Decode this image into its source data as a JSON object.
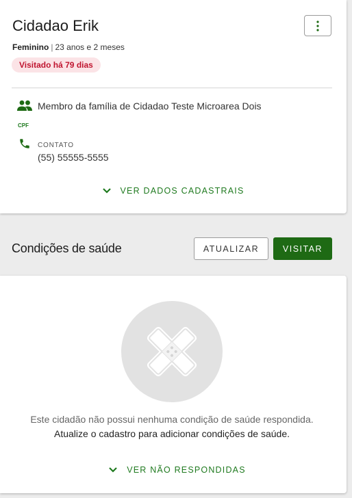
{
  "patient": {
    "name": "Cidadao Erik",
    "gender": "Feminino",
    "separator": "|",
    "age": "23 anos e 2 meses",
    "visit_badge": "Visitado há 79 dias",
    "family_text": "Membro da família de Cidadao Teste Microarea Dois",
    "cpf_tag": "CPF",
    "contact_label": "CONTATO",
    "contact_value": "(55) 55555-5555",
    "more_link": "VER DADOS CADASTRAIS"
  },
  "health": {
    "title": "Condições de saúde",
    "update_button": "ATUALIZAR",
    "visit_button": "VISITAR",
    "empty_line1": "Este cidadão não possui nenhuma condição de saúde respondida.",
    "empty_line2": "Atualize o cadastro para adicionar condições de saúde.",
    "unanswered_link": "VER NÃO RESPONDIDAS"
  },
  "icons": {
    "menu": "more-vertical-icon",
    "family": "people-icon",
    "phone": "phone-icon",
    "chevron": "chevron-down-icon",
    "empty": "bandage-icon"
  },
  "colors": {
    "primary_green": "#1e6a14",
    "link_green": "#1f7a1f",
    "badge_bg": "#fbe3e6",
    "badge_text": "#c0142f",
    "background": "#ececec"
  }
}
